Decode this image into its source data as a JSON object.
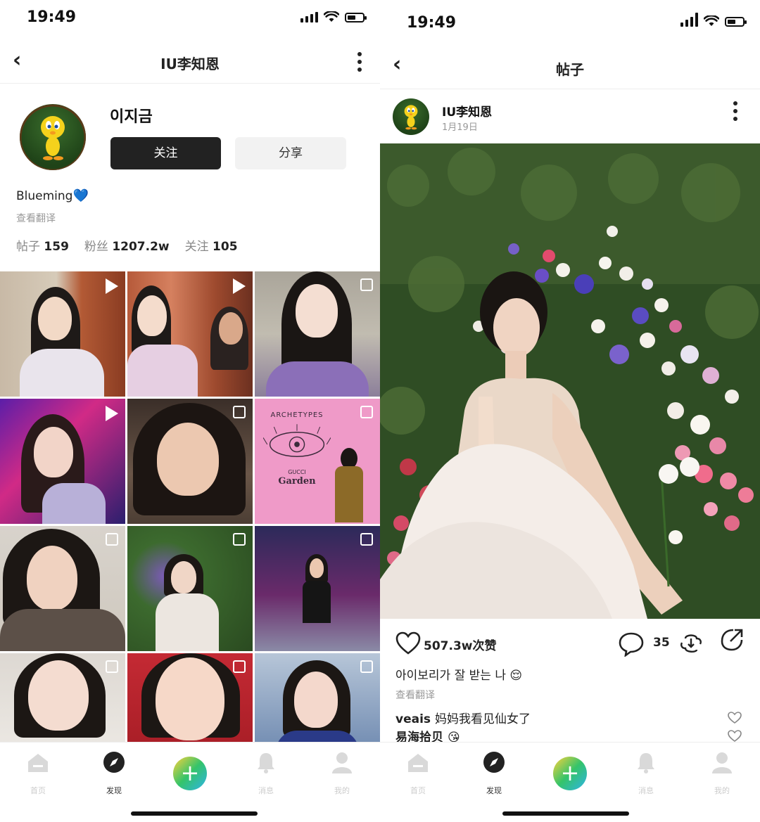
{
  "left": {
    "status": {
      "time": "19:49"
    },
    "nav": {
      "title": "IU李知恩"
    },
    "profile": {
      "name": "이지금",
      "follow_label": "关注",
      "share_label": "分享",
      "bio": "Blueming",
      "bio_emoji": "💙",
      "translate": "查看翻译",
      "stats": {
        "posts_label": "帖子",
        "posts_value": "159",
        "fans_label": "粉丝",
        "fans_value": "1207.2w",
        "following_label": "关注",
        "following_value": "105"
      }
    },
    "grid": {
      "cells": [
        {
          "type": "video"
        },
        {
          "type": "video"
        },
        {
          "type": "multi"
        },
        {
          "type": "video"
        },
        {
          "type": "multi"
        },
        {
          "type": "multi",
          "line1": "ARCHETYPES",
          "line2": "GUCCI",
          "line3": "Garden"
        },
        {
          "type": "multi"
        },
        {
          "type": "multi"
        },
        {
          "type": "multi"
        },
        {
          "type": "multi"
        },
        {
          "type": "multi"
        },
        {
          "type": "multi"
        }
      ]
    },
    "tabs": [
      {
        "label": "首页",
        "icon": "home-icon"
      },
      {
        "label": "发现",
        "icon": "compass-icon"
      },
      {
        "label": "",
        "icon": "plus-icon"
      },
      {
        "label": "消息",
        "icon": "bell-icon"
      },
      {
        "label": "我的",
        "icon": "user-icon"
      }
    ]
  },
  "right": {
    "status": {
      "time": "19:49"
    },
    "nav": {
      "title": "帖子"
    },
    "author": {
      "name": "IU李知恩",
      "date": "1月19日"
    },
    "actions": {
      "likes": "507.3w次赞",
      "comments": "35"
    },
    "caption": "아이보리가 잘 받는 나 😌",
    "translate": "查看翻译",
    "comments": [
      {
        "user": "veais",
        "text": "妈妈我看见仙女了"
      },
      {
        "user": "易海拾贝",
        "text": "😘"
      }
    ],
    "tabs": [
      {
        "label": "首页",
        "icon": "home-icon"
      },
      {
        "label": "发现",
        "icon": "compass-icon"
      },
      {
        "label": "",
        "icon": "plus-icon"
      },
      {
        "label": "消息",
        "icon": "bell-icon"
      },
      {
        "label": "我的",
        "icon": "user-icon"
      }
    ]
  }
}
